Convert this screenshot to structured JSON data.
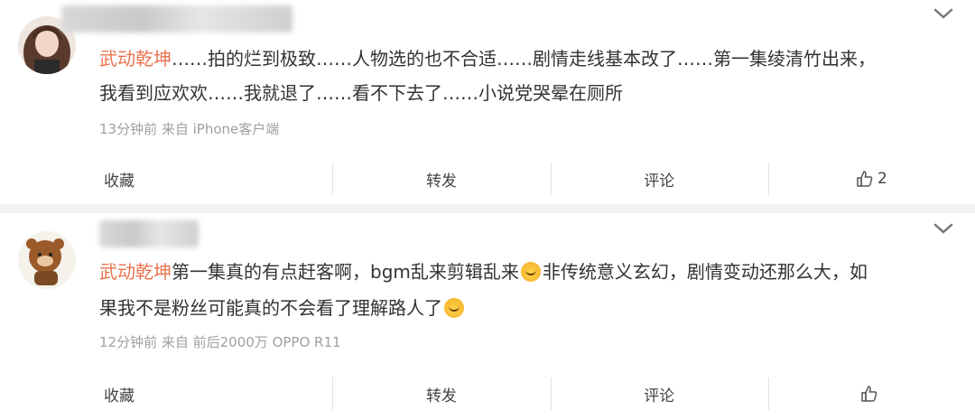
{
  "posts": [
    {
      "mention": "武动乾坤",
      "text_line1": "……拍的烂到极致……人物选的也不合适……剧情走线基本改了……第一集绫清竹出来，",
      "text_line2": "我看到应欢欢……我就退了……看不下去了……小说党哭晕在厕所",
      "meta": "13分钟前 来自 iPhone客户端",
      "actions": {
        "collect": "收藏",
        "repost": "转发",
        "comment": "评论",
        "like_count": "2"
      }
    },
    {
      "mention": "武动乾坤",
      "text_line1_a": "第一集真的有点赶客啊，bgm乱来剪辑乱来",
      "text_line1_b": "非传统意义玄幻，剧情变动还那么大，如",
      "text_line2": "果我不是粉丝可能真的不会看了理解路人了",
      "meta": "12分钟前 来自 前后2000万 OPPO R11",
      "actions": {
        "collect": "收藏",
        "repost": "转发",
        "comment": "评论",
        "like_count": ""
      }
    }
  ],
  "icons": {
    "expand": "chevron-down-icon",
    "like": "thumbs-up-icon",
    "emoji": "laughing-crying-emoji-icon"
  },
  "colors": {
    "mention": "#eb7350",
    "meta": "#a0a0a0",
    "divider": "#f2f2f2"
  }
}
